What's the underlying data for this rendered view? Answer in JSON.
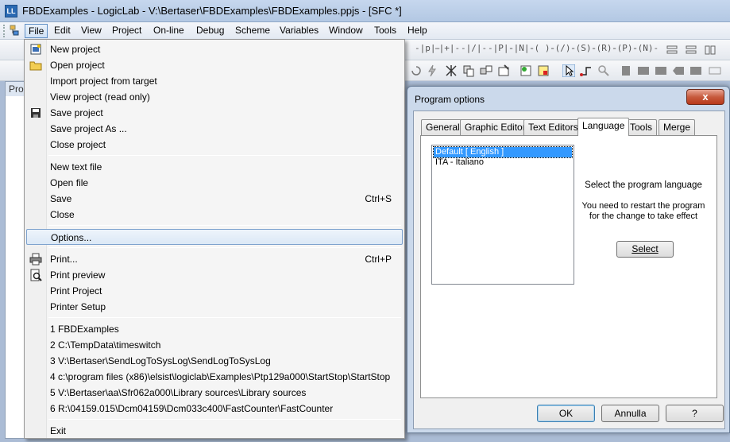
{
  "window": {
    "title": "FBDExamples - LogicLab - V:\\Bertaser\\FBDExamples\\FBDExamples.ppjs - [SFC *]",
    "app_icon_text": "LL"
  },
  "menubar": {
    "items": [
      "File",
      "Edit",
      "View",
      "Project",
      "On-line",
      "Debug",
      "Scheme",
      "Variables",
      "Window",
      "Tools",
      "Help"
    ],
    "active": "File"
  },
  "toolbar_ladder": [
    "-|p|-",
    "-|+|-",
    "-|/|-",
    "-|P|-",
    "-|N|-",
    "-( )-",
    "-(/)-",
    "-(S)-",
    "-(R)-",
    "-(P)-",
    "-(N)-"
  ],
  "project_pane": {
    "header": "Pro"
  },
  "file_menu": {
    "items": [
      {
        "label": "New project",
        "shortcut": "",
        "icon": "new-project-icon"
      },
      {
        "label": "Open project",
        "shortcut": "",
        "icon": "open-folder-icon"
      },
      {
        "label": "Import project from target",
        "shortcut": "",
        "icon": ""
      },
      {
        "label": "View project (read only)",
        "shortcut": "",
        "icon": ""
      },
      {
        "label": "Save project",
        "shortcut": "",
        "icon": "save-icon"
      },
      {
        "label": "Save project As ...",
        "shortcut": "",
        "icon": ""
      },
      {
        "label": "Close project",
        "shortcut": "",
        "icon": ""
      },
      {
        "label": "New text file",
        "shortcut": "",
        "icon": ""
      },
      {
        "label": "Open file",
        "shortcut": "",
        "icon": ""
      },
      {
        "label": "Save",
        "shortcut": "Ctrl+S",
        "icon": ""
      },
      {
        "label": "Close",
        "shortcut": "",
        "icon": ""
      },
      {
        "label": "Options...",
        "shortcut": "",
        "icon": ""
      },
      {
        "label": "Print...",
        "shortcut": "Ctrl+P",
        "icon": "printer-icon"
      },
      {
        "label": "Print preview",
        "shortcut": "",
        "icon": "print-preview-icon"
      },
      {
        "label": "Print Project",
        "shortcut": "",
        "icon": ""
      },
      {
        "label": "Printer Setup",
        "shortcut": "",
        "icon": ""
      },
      {
        "label": "1 FBDExamples",
        "shortcut": "",
        "icon": ""
      },
      {
        "label": "2 C:\\TempData\\timeswitch",
        "shortcut": "",
        "icon": ""
      },
      {
        "label": "3 V:\\Bertaser\\SendLogToSysLog\\SendLogToSysLog",
        "shortcut": "",
        "icon": ""
      },
      {
        "label": "4 c:\\program files (x86)\\elsist\\logiclab\\Examples\\Ptp129a000\\StartStop\\StartStop",
        "shortcut": "",
        "icon": ""
      },
      {
        "label": "5 V:\\Bertaser\\aa\\Sfr062a000\\Library sources\\Library sources",
        "shortcut": "",
        "icon": ""
      },
      {
        "label": "6 R:\\04159.015\\Dcm04159\\Dcm033c400\\FastCounter\\FastCounter",
        "shortcut": "",
        "icon": ""
      },
      {
        "label": "Exit",
        "shortcut": "",
        "icon": ""
      }
    ],
    "highlighted": "Options..."
  },
  "dialog": {
    "title": "Program options",
    "close_label": "x",
    "tabs": [
      "General",
      "Graphic Editor",
      "Text Editors",
      "Language",
      "Tools",
      "Merge"
    ],
    "selected_tab": "Language",
    "languages": [
      "Default [ English ]",
      "ITA - Italiano"
    ],
    "selected_language": "Default [ English ]",
    "prompt": "Select the program language",
    "restart_note_line1": "You need to restart the program",
    "restart_note_line2": "for the change to take effect",
    "select_button": "Select",
    "ok_button": "OK",
    "cancel_button": "Annulla",
    "help_button": "?"
  }
}
